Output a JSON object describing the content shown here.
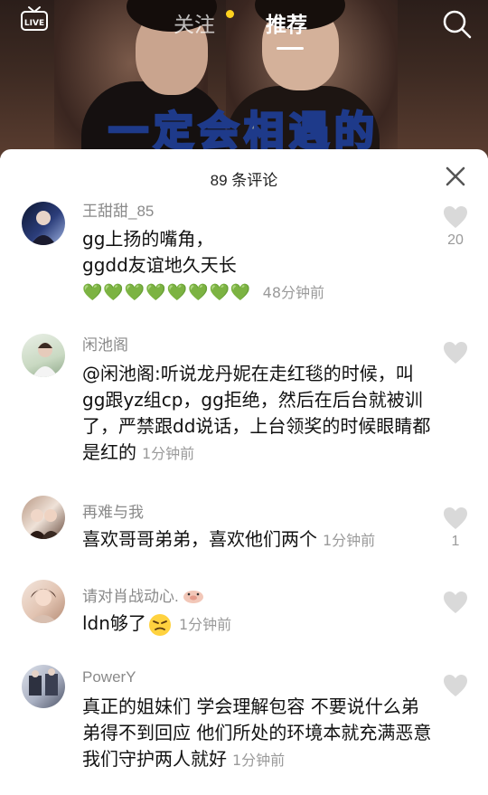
{
  "top_nav": {
    "live_label": "LIVE",
    "tab_follow": "关注",
    "tab_recommend": "推荐"
  },
  "video": {
    "banner_text": "一定会相遇的"
  },
  "comments_sheet": {
    "title": "89 条评论",
    "comments": [
      {
        "name": "王甜甜_85",
        "lines": [
          "gg上扬的嘴角，",
          "ggdd友谊地久天长"
        ],
        "emoji_line": "💚💚💚💚💚💚💚💚",
        "time": "48分钟前",
        "likes": "20"
      },
      {
        "name": "闲池阁",
        "text": "@闲池阁:听说龙丹妮在走红毯的时候，叫gg跟yz组cp，gg拒绝，然后在后台就被训了，严禁跟dd说话，上台领奖的时候眼睛都是红的",
        "time": "1分钟前",
        "likes": ""
      },
      {
        "name": "再难与我",
        "text": "喜欢哥哥弟弟，喜欢他们两个",
        "time": "1分钟前",
        "likes": "1"
      },
      {
        "name": "请对肖战动心.",
        "text": "ldn够了",
        "time": "1分钟前",
        "likes": ""
      },
      {
        "name": "PowerY",
        "text": "真正的姐妹们 学会理解包容 不要说什么弟弟得不到回应 他们所处的环境本就充满恶意 我们守护两人就好",
        "time": "1分钟前",
        "likes": ""
      }
    ]
  },
  "colors": {
    "accent_dot": "#ffd21f",
    "heart_gray": "#d9d9d9",
    "meta_gray": "#9a9a9a"
  }
}
